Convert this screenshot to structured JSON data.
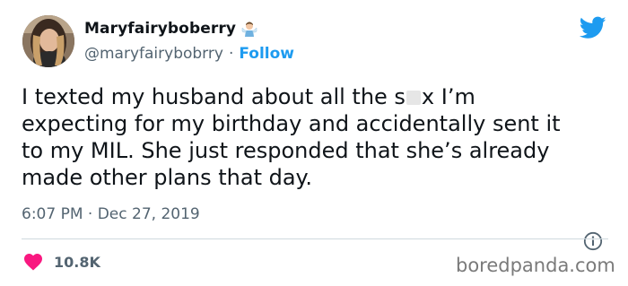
{
  "author": {
    "display_name": "Maryfairyboberry",
    "handle": "@maryfairybobrry",
    "separator": "·",
    "follow_label": "Follow"
  },
  "tweet": {
    "lines": [
      {
        "before": "I texted my husband about all the s",
        "after": "x I’m"
      },
      {
        "text": "expecting for my birthday and accidentally sent it"
      },
      {
        "text": "to my MIL. She just responded that she’s already"
      },
      {
        "text": "made other plans that day."
      }
    ]
  },
  "meta": {
    "timestamp": "6:07 PM · Dec 27, 2019"
  },
  "engagement": {
    "likes": "10.8K"
  },
  "watermark": "boredpanda.com",
  "icons": {
    "logo": "twitter-bird-icon",
    "info": "info-icon",
    "like": "heart-icon",
    "badge": "fairy-emoji-icon"
  },
  "colors": {
    "accent_blue": "#1d9bf0",
    "like_pink": "#f91880",
    "secondary_text": "#536471"
  }
}
